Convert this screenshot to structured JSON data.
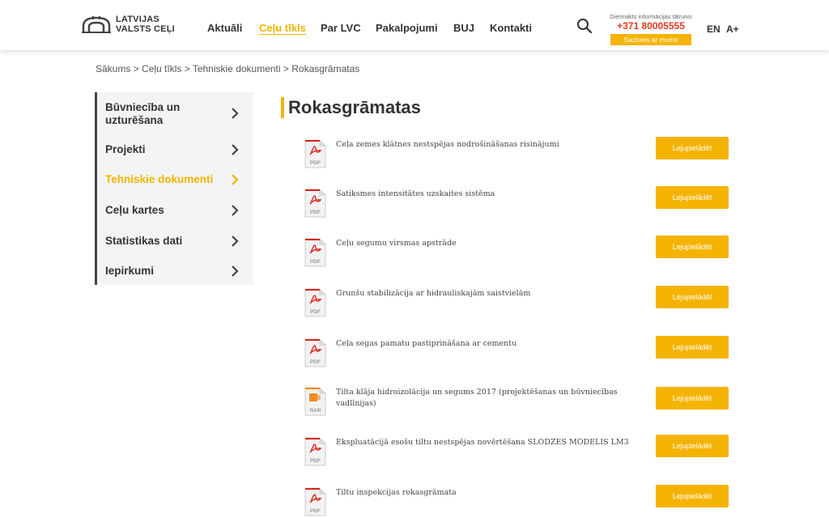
{
  "header": {
    "logo_line1": "LATVIJAS",
    "logo_line2": "VALSTS CEĻI",
    "nav": [
      "Aktuāli",
      "Ceļu tīkls",
      "Par LVC",
      "Pakalpojumi",
      "BUJ",
      "Kontakti"
    ],
    "active_nav": "Ceļu tīkls",
    "hotline_label": "Diennakts informācijas tālrunis",
    "hotline_phone": "+371 80005555",
    "contact_button": "Sazinies ar mums",
    "lang": "EN",
    "font_size": "A+"
  },
  "breadcrumb": "Sākums > Ceļu tīkls > Tehniskie dokumenti > Rokasgrāmatas",
  "sidebar": {
    "items": [
      "Būvniecība un uzturēšana",
      "Projekti",
      "Tehniskie dokumenti",
      "Ceļu kartes",
      "Statistikas dati",
      "Iepirkumi"
    ],
    "active": "Tehniskie dokumenti"
  },
  "main": {
    "title": "Rokasgrāmatas",
    "download_label": "Lejupielādēt",
    "documents": [
      {
        "title": "Ceļa zemes klātnes nestspējas nodrošināšanas risinājumi",
        "type": "PDF"
      },
      {
        "title": "Satiksmes intensitātes uzskaites sistēma",
        "type": "PDF"
      },
      {
        "title": "Ceļu segumu virsmas apstrāde",
        "type": "PDF"
      },
      {
        "title": "Grunšu stabilizācija ar hidrauliskajām saistvielām",
        "type": "PDF"
      },
      {
        "title": "Ceļa segas pamatu pastiprināšana ar cementu",
        "type": "PDF"
      },
      {
        "title": "Tilta klāja hidroizolācija un segums 2017 (projektēšanas un būvniecības vadlīnijas)",
        "type": "RAR"
      },
      {
        "title": "Ekspluatācijā esošu tiltu nestspējas novērtēšana SLODZES MODELIS LM3",
        "type": "PDF"
      },
      {
        "title": "Tiltu inspekcijas rokasgrāmata",
        "type": "PDF"
      }
    ]
  },
  "colors": {
    "accent": "#f5b301",
    "phone": "#e03a1e",
    "pdf_red": "#d9251d",
    "rar_orange": "#f08a24"
  }
}
